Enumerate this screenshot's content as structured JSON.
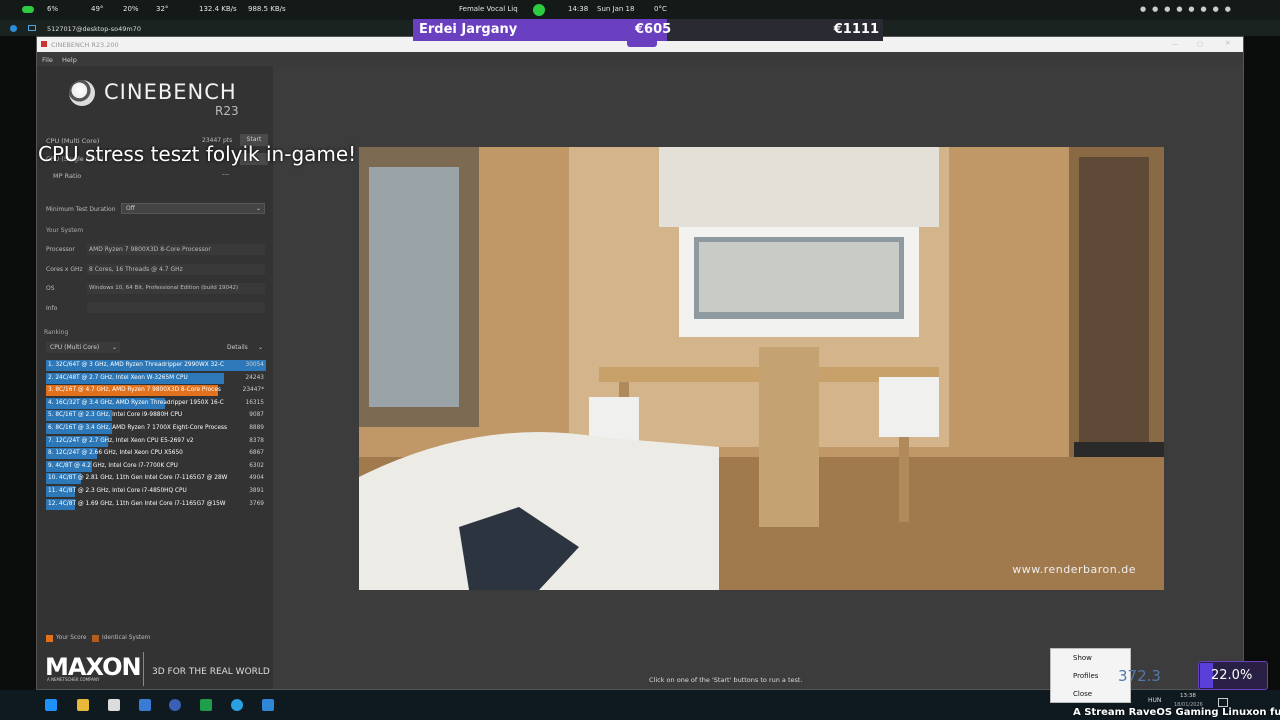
{
  "topbar": {
    "cpu": "6%",
    "temp1": "49°",
    "mem": "20%",
    "temp2": "32°",
    "net_down": "132.4 KB/s",
    "net_up": "988.5 KB/s",
    "media": "Female Vocal Liq",
    "time": "14:38",
    "date": "Sun Jan 18",
    "weather": "0°C"
  },
  "secbar": {
    "remote": "5127017@desktop-so49m70"
  },
  "donation": {
    "name": "Erdei Jargany",
    "current": "€605",
    "goal": "€1111",
    "progress": 0.54
  },
  "window": {
    "title": "CINEBENCH R23.200"
  },
  "menu": {
    "file": "File",
    "help": "Help"
  },
  "logo": {
    "brand": "CINEBENCH",
    "version": "R23"
  },
  "tests": {
    "multi_label": "CPU (Multi Core)",
    "multi_score": "23447 pts",
    "start": "Start",
    "single_label": "CPU (Single Core)",
    "mp_label": "MP Ratio",
    "mp_value": "---"
  },
  "duration": {
    "label": "Minimum Test Duration",
    "value": "Off"
  },
  "system": {
    "heading": "Your System",
    "processor_label": "Processor",
    "processor": "AMD Ryzen 7 9800X3D 8-Core Processor",
    "cores_label": "Cores x GHz",
    "cores": "8 Cores, 16 Threads @ 4.7 GHz",
    "os_label": "OS",
    "os": "Windows 10, 64 Bit, Professional Edition (build 19042)",
    "info_label": "Info",
    "info": ""
  },
  "ranking": {
    "heading": "Ranking",
    "filter": "CPU (Multi Core)",
    "details": "Details",
    "rows": [
      {
        "text": "1. 32C/64T @ 3 GHz, AMD Ryzen Threadripper 2990WX 32-C",
        "score": "30054",
        "frac": 1.0,
        "mine": false
      },
      {
        "text": "2. 24C/48T @ 2.7 GHz, Intel Xeon W-3265M CPU",
        "score": "24243",
        "frac": 0.81,
        "mine": false
      },
      {
        "text": "3. 8C/16T @ 4.7 GHz, AMD Ryzen 7 9800X3D 8-Core Proces",
        "score": "23447*",
        "frac": 0.78,
        "mine": true
      },
      {
        "text": "4. 16C/32T @ 3.4 GHz, AMD Ryzen Threadripper 1950X 16-C",
        "score": "16315",
        "frac": 0.54,
        "mine": false
      },
      {
        "text": "5. 8C/16T @ 2.3 GHz, Intel Core i9-9880H CPU",
        "score": "9087",
        "frac": 0.3,
        "mine": false
      },
      {
        "text": "6. 8C/16T @ 3.4 GHz, AMD Ryzen 7 1700X Eight-Core Process",
        "score": "8889",
        "frac": 0.3,
        "mine": false
      },
      {
        "text": "7. 12C/24T @ 2.7 GHz, Intel Xeon CPU E5-2697 v2",
        "score": "8378",
        "frac": 0.28,
        "mine": false
      },
      {
        "text": "8. 12C/24T @ 2.66 GHz, Intel Xeon CPU X5650",
        "score": "6867",
        "frac": 0.23,
        "mine": false
      },
      {
        "text": "9. 4C/8T @ 4.2 GHz, Intel Core i7-7700K CPU",
        "score": "6302",
        "frac": 0.21,
        "mine": false
      },
      {
        "text": "10. 4C/8T @ 2.81 GHz, 11th Gen Intel Core i7-1165G7 @ 28W",
        "score": "4904",
        "frac": 0.16,
        "mine": false
      },
      {
        "text": "11. 4C/8T @ 2.3 GHz, Intel Core i7-4850HQ CPU",
        "score": "3891",
        "frac": 0.13,
        "mine": false
      },
      {
        "text": "12. 4C/8T @ 1.69 GHz, 11th Gen Intel Core i7-1165G7 @15W",
        "score": "3769",
        "frac": 0.13,
        "mine": false
      }
    ]
  },
  "legend": {
    "your_score": "Your Score",
    "identical": "Identical System"
  },
  "maxon": {
    "brand": "MAXON",
    "sub": "A NEMETSCHEK COMPANY",
    "tagline": "3D FOR THE REAL WORLD"
  },
  "render": {
    "watermark": "www.renderbaron.de"
  },
  "overlay_caption": "CPU stress teszt folyik in-game!",
  "hint": "Click on one of the 'Start' buttons to run a test.",
  "context_menu": {
    "show": "Show",
    "profiles": "Profiles",
    "close": "Close"
  },
  "tray": {
    "watts": "372.3",
    "percent": "22.0%",
    "lang": "HUN",
    "clock": "13:38",
    "date": "18/01/2026"
  },
  "ticker": "A Stream RaveOS Gaming Linuxon fut"
}
